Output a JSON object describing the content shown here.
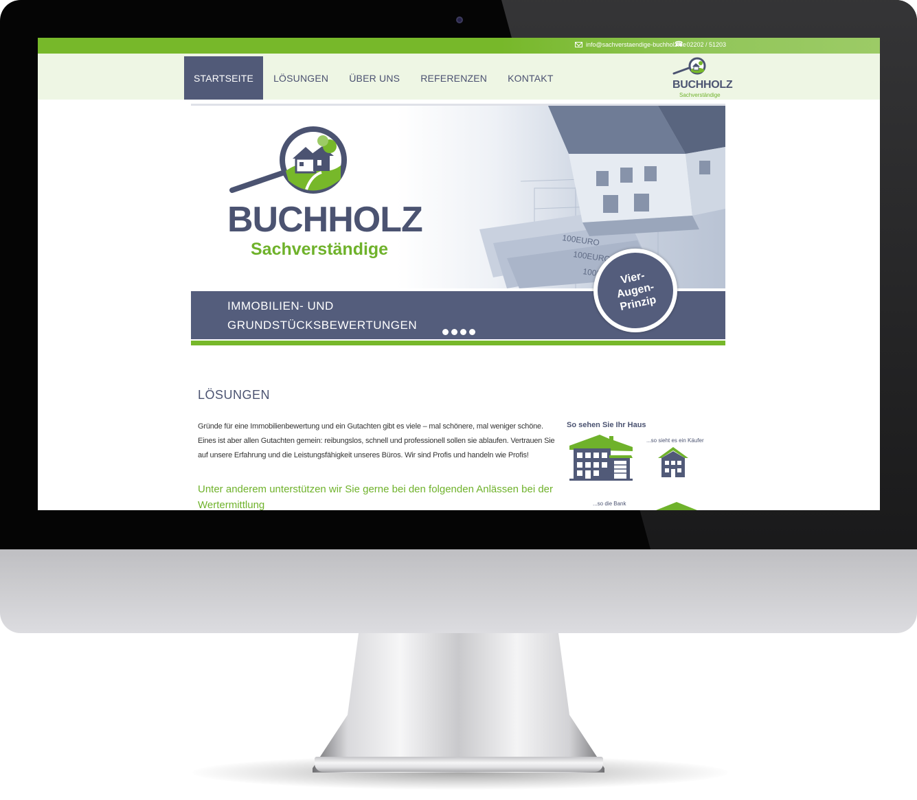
{
  "topbar": {
    "email": "info@sachverstaendige-buchholz.de",
    "phone": "02202 / 51203"
  },
  "nav": {
    "items": [
      {
        "label": "STARTSEITE",
        "active": true
      },
      {
        "label": "LÖSUNGEN",
        "active": false
      },
      {
        "label": "ÜBER UNS",
        "active": false
      },
      {
        "label": "REFERENZEN",
        "active": false
      },
      {
        "label": "KONTAKT",
        "active": false
      }
    ]
  },
  "logo": {
    "title": "BUCHHOLZ",
    "subtitle": "Sachverständige"
  },
  "hero": {
    "title": "BUCHHOLZ",
    "subtitle": "Sachverständige",
    "band_line1": "IMMOBILIEN- UND",
    "band_line2": "GRUNDSTÜCKSBEWERTUNGEN",
    "badge": [
      "Vier-",
      "Augen-",
      "Prinzip"
    ],
    "slides": 4,
    "photo_text": [
      "100EURO",
      "100EURO",
      "100EURO"
    ]
  },
  "content": {
    "section_title": "LÖSUNGEN",
    "intro_lines": [
      "Gründe für eine Immobilienbewertung und ein Gutachten gibt es viele – mal schönere, mal weniger schöne.",
      "Eines ist aber allen Gutachten gemein: reibungslos, schnell und professionell sollen sie ablaufen. Vertrauen Sie",
      "auf unsere Erfahrung und die Leistungsfähigkeit unseres Büros. Wir sind Profis und handeln wie Profis!"
    ],
    "subhead": "Unter anderem unterstützen wir Sie gerne bei den folgenden Anlässen bei der Wertermittlung"
  },
  "aside": {
    "title": "So sehen Sie Ihr Haus",
    "buyer_caption": "...so sieht es ein Käufer",
    "bank_caption": "...so die Bank"
  },
  "colors": {
    "brand_green": "#77b82a",
    "brand_navy": "#515a78",
    "nav_background": "#eef6e4"
  },
  "icons": [
    "mail-icon",
    "phone-icon",
    "magnifier-house-icon",
    "house-icon"
  ]
}
